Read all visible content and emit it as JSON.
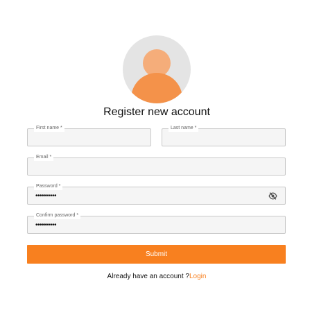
{
  "colors": {
    "accent": "#f8801f",
    "avatar_background": "#e4e4e4",
    "avatar_head": "#f5ad7a",
    "avatar_body": "#f4924a"
  },
  "form": {
    "title": "Register new account",
    "fields": {
      "first_name": {
        "label": "First name *",
        "value": ""
      },
      "last_name": {
        "label": "Last name *",
        "value": ""
      },
      "email": {
        "label": "Email *",
        "value": ""
      },
      "password": {
        "label": "Password *",
        "value": "••••••••••",
        "toggle_icon": "eye-off-icon"
      },
      "confirm_password": {
        "label": "Confirm password *",
        "value": "••••••••••"
      }
    },
    "submit_label": "Submit",
    "footer_text": "Already have an account ?",
    "login_link": "Login"
  }
}
